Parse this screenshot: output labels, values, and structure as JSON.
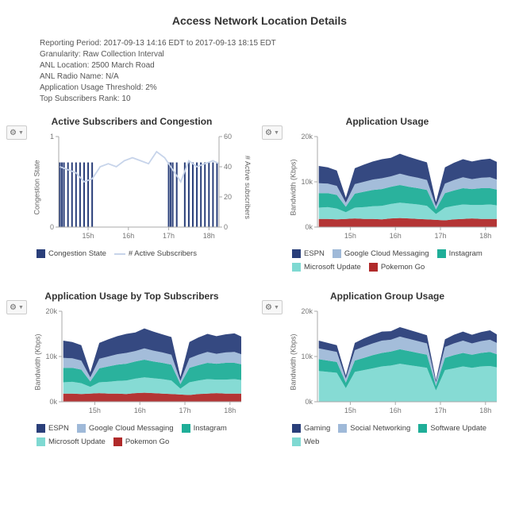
{
  "title": "Access Network Location Details",
  "meta": [
    "Reporting Period: 2017-09-13 14:16 EDT to 2017-09-13 18:15 EDT",
    "Granularity: Raw Collection Interval",
    "ANL Location: 2500 March Road",
    "ANL Radio Name: N/A",
    "Application Usage Threshold: 2%",
    "Top Subscribers Rank: 10"
  ],
  "palette": {
    "espn": "#2a3f7a",
    "gcm": "#9fb9d8",
    "instagram": "#1fae98",
    "msupdate": "#7fd9d2",
    "pokemon": "#b02a2a",
    "gaming": "#2a3f7a",
    "social": "#9fb9d8",
    "software": "#1fae98",
    "web": "#7fd9d2",
    "congestion": "#2a3f7a",
    "active": "#c7d4ea"
  },
  "panels": {
    "p1": {
      "title": "Active Subscribers and Congestion",
      "ylabel": "Congestion State",
      "ylabel2": "# Active subscribers",
      "legend": [
        {
          "label": "Congestion State",
          "color": "#2a3f7a",
          "shape": "box"
        },
        {
          "label": "# Active Subscribers",
          "color": "#c7d4ea",
          "shape": "line"
        }
      ]
    },
    "p2": {
      "title": "Application Usage",
      "ylabel": "Bandwidth (Kbps)",
      "legend": [
        {
          "label": "ESPN",
          "color": "#2a3f7a",
          "shape": "box"
        },
        {
          "label": "Google Cloud Messaging",
          "color": "#9fb9d8",
          "shape": "box"
        },
        {
          "label": "Instagram",
          "color": "#1fae98",
          "shape": "box"
        },
        {
          "label": "Microsoft Update",
          "color": "#7fd9d2",
          "shape": "box"
        },
        {
          "label": "Pokemon Go",
          "color": "#b02a2a",
          "shape": "box"
        }
      ]
    },
    "p3": {
      "title": "Application Usage by Top Subscribers",
      "ylabel": "Bandwidth (Kbps)",
      "legend": [
        {
          "label": "ESPN",
          "color": "#2a3f7a",
          "shape": "box"
        },
        {
          "label": "Google Cloud Messaging",
          "color": "#9fb9d8",
          "shape": "box"
        },
        {
          "label": "Instagram",
          "color": "#1fae98",
          "shape": "box"
        },
        {
          "label": "Microsoft Update",
          "color": "#7fd9d2",
          "shape": "box"
        },
        {
          "label": "Pokemon Go",
          "color": "#b02a2a",
          "shape": "box"
        }
      ]
    },
    "p4": {
      "title": "Application Group Usage",
      "ylabel": "Bandwidth (Kbps)",
      "legend": [
        {
          "label": "Gaming",
          "color": "#2a3f7a",
          "shape": "box"
        },
        {
          "label": "Social Networking",
          "color": "#9fb9d8",
          "shape": "box"
        },
        {
          "label": "Software Update",
          "color": "#1fae98",
          "shape": "box"
        },
        {
          "label": "Web",
          "color": "#7fd9d2",
          "shape": "box"
        }
      ]
    }
  },
  "chart_data": [
    {
      "id": "p1",
      "type": "line-bar-combo",
      "title": "Active Subscribers and Congestion",
      "x_axis": {
        "label_hours": [
          "15h",
          "16h",
          "17h",
          "18h"
        ],
        "range_hours": [
          14.27,
          18.25
        ]
      },
      "left_axis": {
        "label": "Congestion State",
        "ticks": [
          0,
          1
        ],
        "range": [
          0,
          1.4
        ]
      },
      "right_axis": {
        "label": "# Active subscribers",
        "ticks": [
          0,
          20,
          40,
          60
        ],
        "range": [
          0,
          60
        ]
      },
      "series": [
        {
          "name": "Congestion State",
          "axis": "left",
          "style": "bar",
          "color": "#2a3f7a",
          "x": [
            14.3,
            14.35,
            14.4,
            14.5,
            14.6,
            14.7,
            14.8,
            14.9,
            15.0,
            15.1,
            15.4,
            15.6,
            15.8,
            16.0,
            16.2,
            16.4,
            16.6,
            16.8,
            17.0,
            17.05,
            17.1,
            17.2,
            17.3,
            17.4,
            17.5,
            17.6,
            17.7,
            17.8,
            17.9,
            18.0,
            18.1,
            18.2
          ],
          "y": [
            1,
            1,
            1,
            1,
            1,
            1,
            1,
            1,
            1,
            1,
            0,
            0,
            0,
            0,
            0,
            0,
            0,
            0,
            1,
            1,
            1,
            1,
            0,
            1,
            1,
            1,
            1,
            1,
            1,
            1,
            1,
            1
          ]
        },
        {
          "name": "# Active Subscribers",
          "axis": "right",
          "style": "line",
          "color": "#c7d4ea",
          "x": [
            14.3,
            14.5,
            14.7,
            14.9,
            15.1,
            15.3,
            15.5,
            15.7,
            15.9,
            16.1,
            16.3,
            16.5,
            16.7,
            16.9,
            17.1,
            17.3,
            17.5,
            17.7,
            17.9,
            18.1,
            18.25
          ],
          "y": [
            40,
            38,
            36,
            30,
            32,
            40,
            42,
            40,
            44,
            46,
            44,
            42,
            50,
            46,
            38,
            30,
            44,
            40,
            42,
            44,
            42
          ]
        }
      ]
    },
    {
      "id": "p2",
      "type": "area-stacked",
      "title": "Application Usage",
      "x_axis": {
        "label_hours": [
          "15h",
          "16h",
          "17h",
          "18h"
        ],
        "range_hours": [
          14.27,
          18.25
        ]
      },
      "y_axis": {
        "label": "Bandwidth (Kbps)",
        "ticks": [
          0,
          10000,
          20000
        ],
        "tick_labels": [
          "0k",
          "10k",
          "20k"
        ],
        "range": [
          0,
          20000
        ]
      },
      "series_order": [
        "Pokemon Go",
        "Microsoft Update",
        "Instagram",
        "Google Cloud Messaging",
        "ESPN"
      ],
      "series": [
        {
          "name": "Pokemon Go",
          "color": "#b02a2a",
          "values": [
            1800,
            1800,
            1700,
            1800,
            1900,
            1800,
            1800,
            1700,
            1900,
            2000,
            1900,
            1800,
            1700,
            1600,
            1500,
            1700,
            1800,
            1900,
            1800,
            1800,
            1800
          ]
        },
        {
          "name": "Microsoft Update",
          "color": "#7fd9d2",
          "values": [
            2500,
            2600,
            2400,
            1500,
            2400,
            2600,
            2800,
            3000,
            3200,
            3400,
            3300,
            3200,
            3000,
            1300,
            2800,
            3000,
            3200,
            3000,
            3100,
            3200,
            3000
          ]
        },
        {
          "name": "Instagram",
          "color": "#1fae98",
          "values": [
            3200,
            3100,
            3000,
            1200,
            3100,
            3400,
            3600,
            3700,
            3800,
            3900,
            3700,
            3600,
            3500,
            1000,
            3200,
            3400,
            3600,
            3500,
            3700,
            3600,
            3500
          ]
        },
        {
          "name": "Google Cloud Messaging",
          "color": "#9fb9d8",
          "values": [
            2200,
            2100,
            2000,
            900,
            2100,
            2200,
            2300,
            2400,
            2300,
            2500,
            2400,
            2300,
            2200,
            700,
            2100,
            2300,
            2400,
            2200,
            2300,
            2400,
            2200
          ]
        },
        {
          "name": "ESPN",
          "color": "#2a3f7a",
          "values": [
            3800,
            3600,
            3400,
            1100,
            3500,
            3800,
            4000,
            4200,
            4100,
            4400,
            4200,
            4000,
            3900,
            900,
            3600,
            3800,
            4000,
            3900,
            4000,
            4100,
            3900
          ]
        }
      ],
      "x": [
        14.3,
        14.5,
        14.7,
        14.9,
        15.1,
        15.3,
        15.5,
        15.7,
        15.9,
        16.1,
        16.3,
        16.5,
        16.7,
        16.9,
        17.1,
        17.3,
        17.5,
        17.7,
        17.9,
        18.1,
        18.25
      ]
    },
    {
      "id": "p3",
      "type": "area-stacked",
      "title": "Application Usage by Top Subscribers",
      "same_as": "p2"
    },
    {
      "id": "p4",
      "type": "area-stacked",
      "title": "Application Group Usage",
      "x_axis": {
        "label_hours": [
          "15h",
          "16h",
          "17h",
          "18h"
        ],
        "range_hours": [
          14.27,
          18.25
        ]
      },
      "y_axis": {
        "label": "Bandwidth (Kbps)",
        "ticks": [
          0,
          10000,
          20000
        ],
        "tick_labels": [
          "0k",
          "10k",
          "20k"
        ],
        "range": [
          0,
          20000
        ]
      },
      "series_order": [
        "Web",
        "Software Update",
        "Social Networking",
        "Gaming"
      ],
      "series": [
        {
          "name": "Web",
          "color": "#7fd9d2",
          "values": [
            6800,
            6600,
            6400,
            3000,
            6600,
            7000,
            7400,
            7800,
            8000,
            8400,
            8100,
            7800,
            7500,
            2500,
            7000,
            7400,
            7800,
            7500,
            7800,
            7900,
            7600
          ]
        },
        {
          "name": "Software Update",
          "color": "#1fae98",
          "values": [
            2600,
            2500,
            2400,
            1200,
            2500,
            2700,
            2900,
            3000,
            3100,
            3200,
            3100,
            3000,
            2900,
            1000,
            2700,
            2900,
            3000,
            2900,
            3000,
            3100,
            2900
          ]
        },
        {
          "name": "Social Networking",
          "color": "#9fb9d8",
          "values": [
            2400,
            2300,
            2200,
            900,
            2300,
            2500,
            2600,
            2700,
            2600,
            2800,
            2700,
            2600,
            2500,
            800,
            2400,
            2600,
            2700,
            2500,
            2600,
            2700,
            2500
          ]
        },
        {
          "name": "Gaming",
          "color": "#2a3f7a",
          "values": [
            1700,
            1600,
            1500,
            700,
            1600,
            1800,
            1900,
            2000,
            1900,
            2100,
            2000,
            1900,
            1800,
            500,
            1700,
            1900,
            2000,
            1900,
            2000,
            2100,
            1900
          ]
        }
      ],
      "x": [
        14.3,
        14.5,
        14.7,
        14.9,
        15.1,
        15.3,
        15.5,
        15.7,
        15.9,
        16.1,
        16.3,
        16.5,
        16.7,
        16.9,
        17.1,
        17.3,
        17.5,
        17.7,
        17.9,
        18.1,
        18.25
      ]
    }
  ]
}
